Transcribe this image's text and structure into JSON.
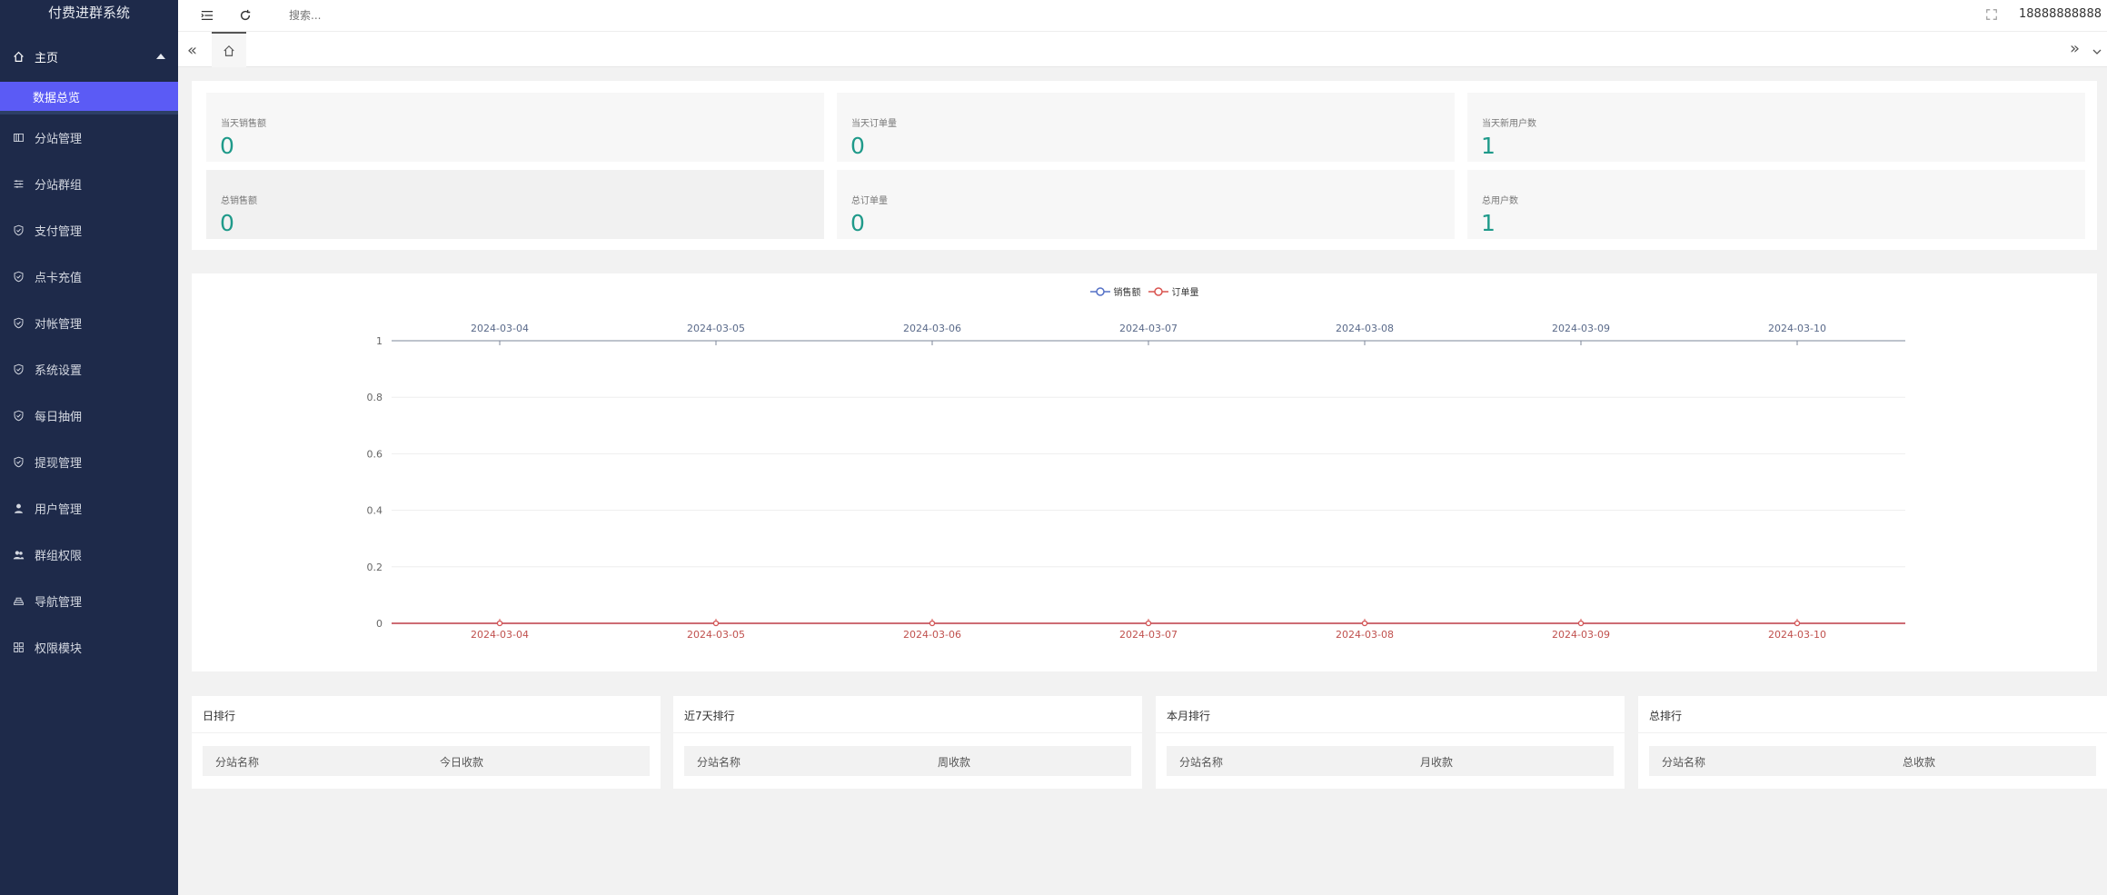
{
  "app": {
    "title": "付费进群系统"
  },
  "sidebar": {
    "home": {
      "label": "主页",
      "icon": "home-icon"
    },
    "active_sub": {
      "label": "数据总览"
    },
    "items": [
      {
        "label": "分站管理",
        "icon": "columns-icon"
      },
      {
        "label": "分站群组",
        "icon": "sliders-icon"
      },
      {
        "label": "支付管理",
        "icon": "shield-check-icon"
      },
      {
        "label": "点卡充值",
        "icon": "shield-check-icon"
      },
      {
        "label": "对帐管理",
        "icon": "shield-check-icon"
      },
      {
        "label": "系统设置",
        "icon": "shield-check-icon"
      },
      {
        "label": "每日抽佣",
        "icon": "shield-check-icon"
      },
      {
        "label": "提现管理",
        "icon": "shield-check-icon"
      },
      {
        "label": "用户管理",
        "icon": "user-icon"
      },
      {
        "label": "群组权限",
        "icon": "users-icon"
      },
      {
        "label": "导航管理",
        "icon": "layers-icon"
      },
      {
        "label": "权限模块",
        "icon": "grid-icon"
      }
    ]
  },
  "topbar": {
    "search_placeholder": "搜索...",
    "user": "18888888888"
  },
  "stats": [
    {
      "label": "当天销售额",
      "value": "0"
    },
    {
      "label": "当天订单量",
      "value": "0"
    },
    {
      "label": "当天新用户数",
      "value": "1"
    },
    {
      "label": "总销售额",
      "value": "0"
    },
    {
      "label": "总订单量",
      "value": "0"
    },
    {
      "label": "总用户数",
      "value": "1"
    }
  ],
  "chart_data": {
    "type": "line",
    "x": [
      "2024-03-04",
      "2024-03-05",
      "2024-03-06",
      "2024-03-07",
      "2024-03-08",
      "2024-03-09",
      "2024-03-10"
    ],
    "series": [
      {
        "name": "销售额",
        "values": [
          0,
          0,
          0,
          0,
          0,
          0,
          0
        ],
        "color": "#5470c6"
      },
      {
        "name": "订单量",
        "values": [
          0,
          0,
          0,
          0,
          0,
          0,
          0
        ],
        "color": "#d9534f"
      }
    ],
    "y_ticks": [
      "1",
      "0.8",
      "0.6",
      "0.4",
      "0.2",
      "0"
    ],
    "ylim": [
      0,
      1
    ],
    "legend_position": "top-center",
    "grid": true
  },
  "rankings": [
    {
      "title": "日排行",
      "col1": "分站名称",
      "col2": "今日收款"
    },
    {
      "title": "近7天排行",
      "col1": "分站名称",
      "col2": "周收款"
    },
    {
      "title": "本月排行",
      "col1": "分站名称",
      "col2": "月收款"
    },
    {
      "title": "总排行",
      "col1": "分站名称",
      "col2": "总收款"
    }
  ],
  "colors": {
    "sidebar_bg": "#1e2a4a",
    "active": "#5b5bf5",
    "stat_value": "#1f9a8a"
  }
}
